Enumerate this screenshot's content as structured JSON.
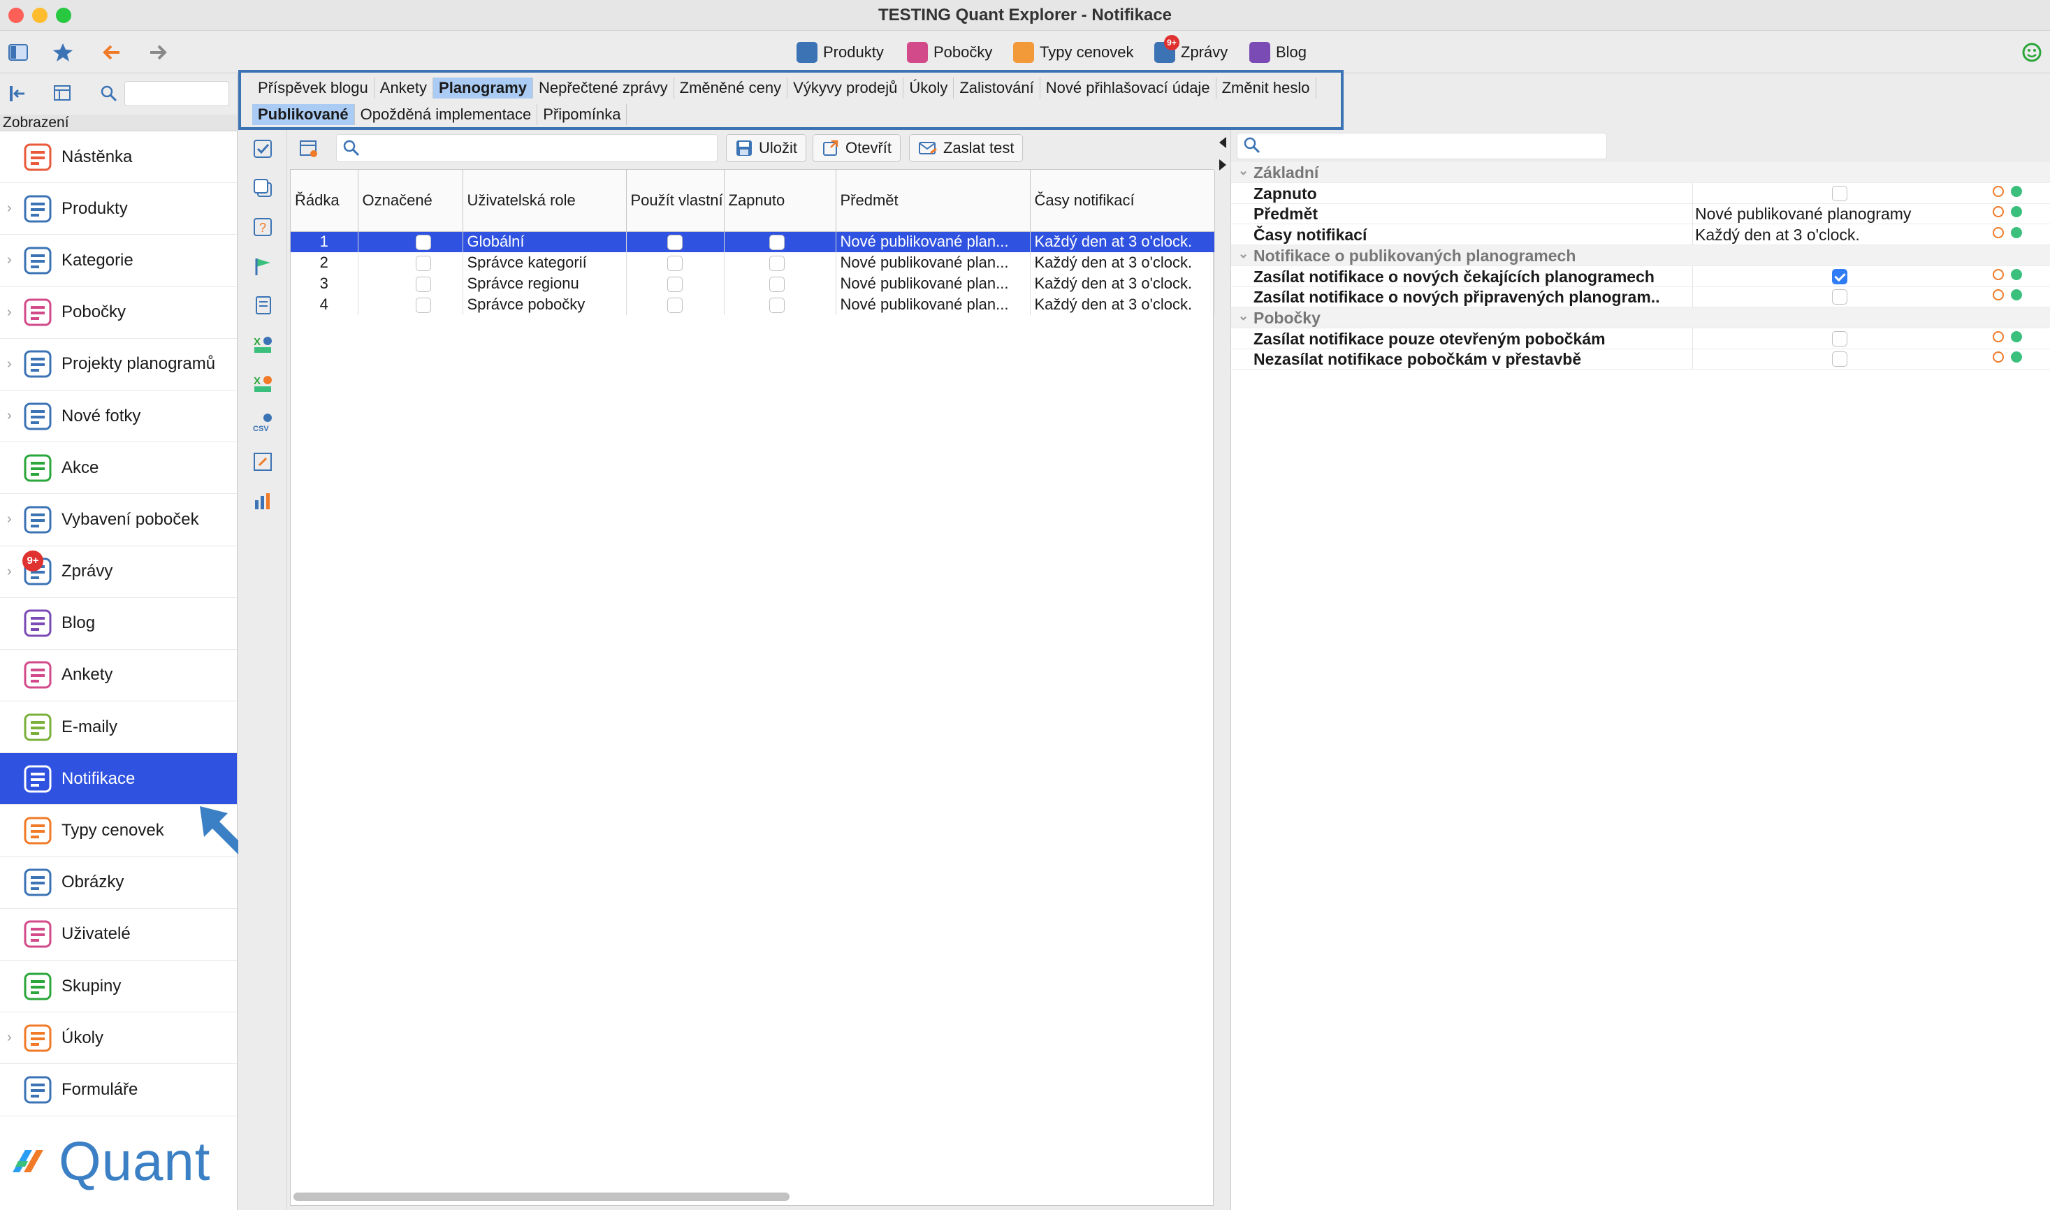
{
  "window": {
    "title": "TESTING Quant Explorer - Notifikace"
  },
  "toolbar": {
    "buttons": [
      {
        "label": "Produkty",
        "icon": "products-icon"
      },
      {
        "label": "Pobočky",
        "icon": "branches-icon"
      },
      {
        "label": "Typy cenovek",
        "icon": "price-tag-icon"
      },
      {
        "label": "Zprávy",
        "icon": "messages-icon",
        "badge": "9+"
      },
      {
        "label": "Blog",
        "icon": "blog-icon"
      }
    ]
  },
  "sidebar": {
    "header": "Zobrazení",
    "active": "Notifikace",
    "items": [
      {
        "label": "Nástěnka",
        "icon": "dashboard-icon",
        "expandable": false
      },
      {
        "label": "Produkty",
        "icon": "products-icon",
        "expandable": true
      },
      {
        "label": "Kategorie",
        "icon": "categories-icon",
        "expandable": true
      },
      {
        "label": "Pobočky",
        "icon": "branches-icon",
        "expandable": true
      },
      {
        "label": "Projekty planogramů",
        "icon": "planogram-projects-icon",
        "expandable": true
      },
      {
        "label": "Nové fotky",
        "icon": "camera-icon",
        "expandable": true
      },
      {
        "label": "Akce",
        "icon": "promo-icon",
        "expandable": false
      },
      {
        "label": "Vybavení poboček",
        "icon": "equipment-icon",
        "expandable": true
      },
      {
        "label": "Zprávy",
        "icon": "messages-icon",
        "expandable": true,
        "badge": "9+"
      },
      {
        "label": "Blog",
        "icon": "blog-icon",
        "expandable": false
      },
      {
        "label": "Ankety",
        "icon": "survey-icon",
        "expandable": false
      },
      {
        "label": "E-maily",
        "icon": "email-icon",
        "expandable": false
      },
      {
        "label": "Notifikace",
        "icon": "notification-icon",
        "expandable": false
      },
      {
        "label": "Typy cenovek",
        "icon": "price-tag-icon",
        "expandable": false
      },
      {
        "label": "Obrázky",
        "icon": "image-icon",
        "expandable": false
      },
      {
        "label": "Uživatelé",
        "icon": "user-icon",
        "expandable": false
      },
      {
        "label": "Skupiny",
        "icon": "groups-icon",
        "expandable": false
      },
      {
        "label": "Úkoly",
        "icon": "tasks-icon",
        "expandable": true
      },
      {
        "label": "Formuláře",
        "icon": "forms-icon",
        "expandable": false
      }
    ],
    "logo": "Quant"
  },
  "tabs": {
    "row1": [
      "Příspěvek blogu",
      "Ankety",
      "Planogramy",
      "Nepřečtené zprávy",
      "Změněné ceny",
      "Výkyvy prodejů",
      "Úkoly",
      "Zalistování",
      "Nové přihlašovací údaje",
      "Změnit heslo"
    ],
    "row1_selected": "Planogramy",
    "row2": [
      "Publikované",
      "Opožděná implementace",
      "Připomínka"
    ],
    "row2_selected": "Publikované"
  },
  "grid_toolbar": {
    "save": "Uložit",
    "open": "Otevřít",
    "send_test": "Zaslat test"
  },
  "grid": {
    "columns": [
      "Řádka",
      "Označené",
      "Uživatelská role",
      "Použít vlastní",
      "Zapnuto",
      "Předmět",
      "Časy notifikací"
    ],
    "rows": [
      {
        "row": "1",
        "role": "Globální",
        "subject": "Nové publikované plan...",
        "times": "Každý den at 3 o'clock.",
        "selected": true
      },
      {
        "row": "2",
        "role": "Správce kategorií",
        "subject": "Nové publikované plan...",
        "times": "Každý den at 3 o'clock.",
        "selected": false
      },
      {
        "row": "3",
        "role": "Správce regionu",
        "subject": "Nové publikované plan...",
        "times": "Každý den at 3 o'clock.",
        "selected": false
      },
      {
        "row": "4",
        "role": "Správce pobočky",
        "subject": "Nové publikované plan...",
        "times": "Každý den at 3 o'clock.",
        "selected": false
      }
    ]
  },
  "properties": {
    "rows": [
      {
        "type": "group",
        "label": "Základní"
      },
      {
        "type": "prop",
        "label": "Zapnuto",
        "checkbox": true,
        "checked": false
      },
      {
        "type": "prop",
        "label": "Předmět",
        "value": "Nové publikované planogramy"
      },
      {
        "type": "prop",
        "label": "Časy notifikací",
        "value": "Každý den at 3 o'clock."
      },
      {
        "type": "group",
        "label": "Notifikace o publikovaných planogramech"
      },
      {
        "type": "prop",
        "label": "Zasílat notifikace o nových čekajících planogramech",
        "checkbox": true,
        "checked": true
      },
      {
        "type": "prop",
        "label": "Zasílat notifikace o nových připravených planogram...",
        "checkbox": true,
        "checked": false
      },
      {
        "type": "group",
        "label": "Pobočky"
      },
      {
        "type": "prop",
        "label": "Zasílat notifikace pouze otevřeným pobočkám",
        "checkbox": true,
        "checked": false
      },
      {
        "type": "prop",
        "label": "Nezasílat notifikace pobočkám v přestavbě",
        "checkbox": true,
        "checked": false
      }
    ]
  },
  "colors": {
    "selection": "#2f52e0",
    "accent": "#3b7fc4",
    "tab_selected": "#aacbf3",
    "badge": "#e03131"
  }
}
